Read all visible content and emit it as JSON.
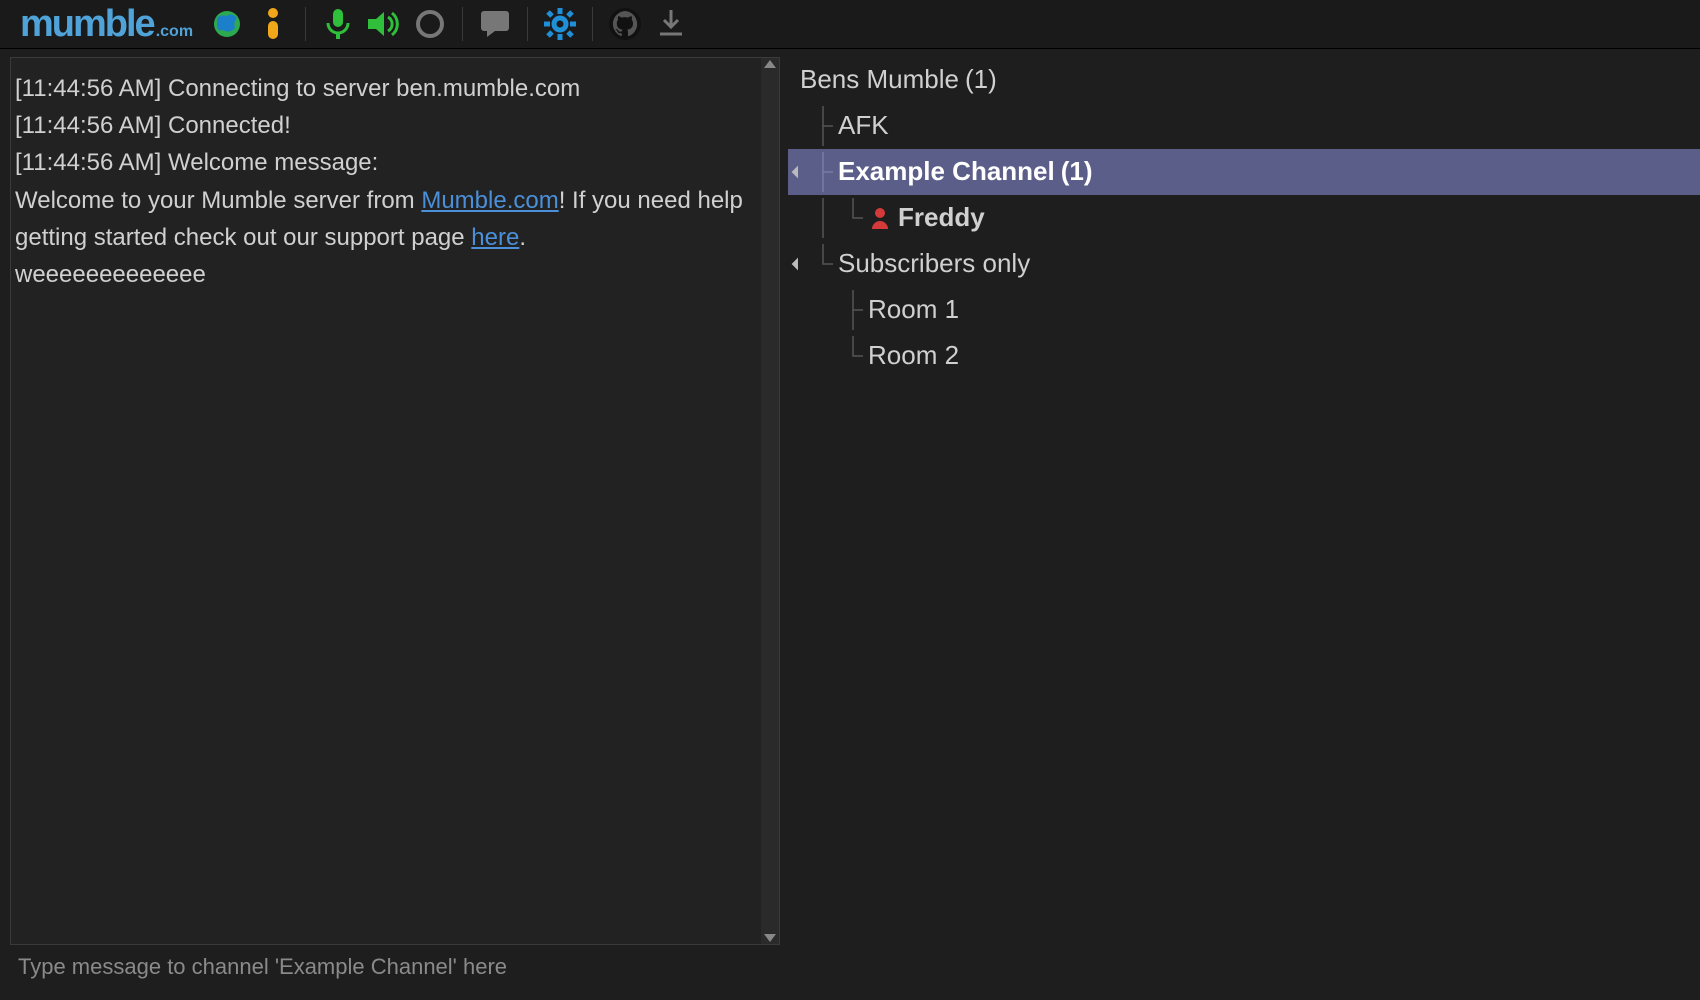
{
  "brand": {
    "main": "mumble",
    "sub": ".com"
  },
  "toolbar": {
    "globe": "globe-icon",
    "info": "info-icon",
    "mic": "microphone-icon",
    "speaker": "speaker-icon",
    "record": "record-icon",
    "comment": "comment-icon",
    "settings": "gear-icon",
    "github": "github-icon",
    "download": "download-icon"
  },
  "log": {
    "ts": "[11:44:56 AM]",
    "line1_text": "Connecting to server ben.mumble.com",
    "line2_text": "Connected!",
    "line3_text": "Welcome message:",
    "welcome_pre": "Welcome to your Mumble server from ",
    "welcome_link1": "Mumble.com",
    "welcome_mid": "! If you need help getting started check out our support page ",
    "welcome_link2": "here",
    "welcome_post": ".",
    "welcome_tail": "weeeeeeeeeeeee"
  },
  "input": {
    "placeholder": "Type message to channel 'Example Channel' here"
  },
  "tree": {
    "root_name": "Bens Mumble",
    "root_count": "(1)",
    "afk": "AFK",
    "example_name": "Example Channel",
    "example_count": "(1)",
    "user1": "Freddy",
    "subs": "Subscribers only",
    "room1": "Room 1",
    "room2": "Room 2"
  }
}
